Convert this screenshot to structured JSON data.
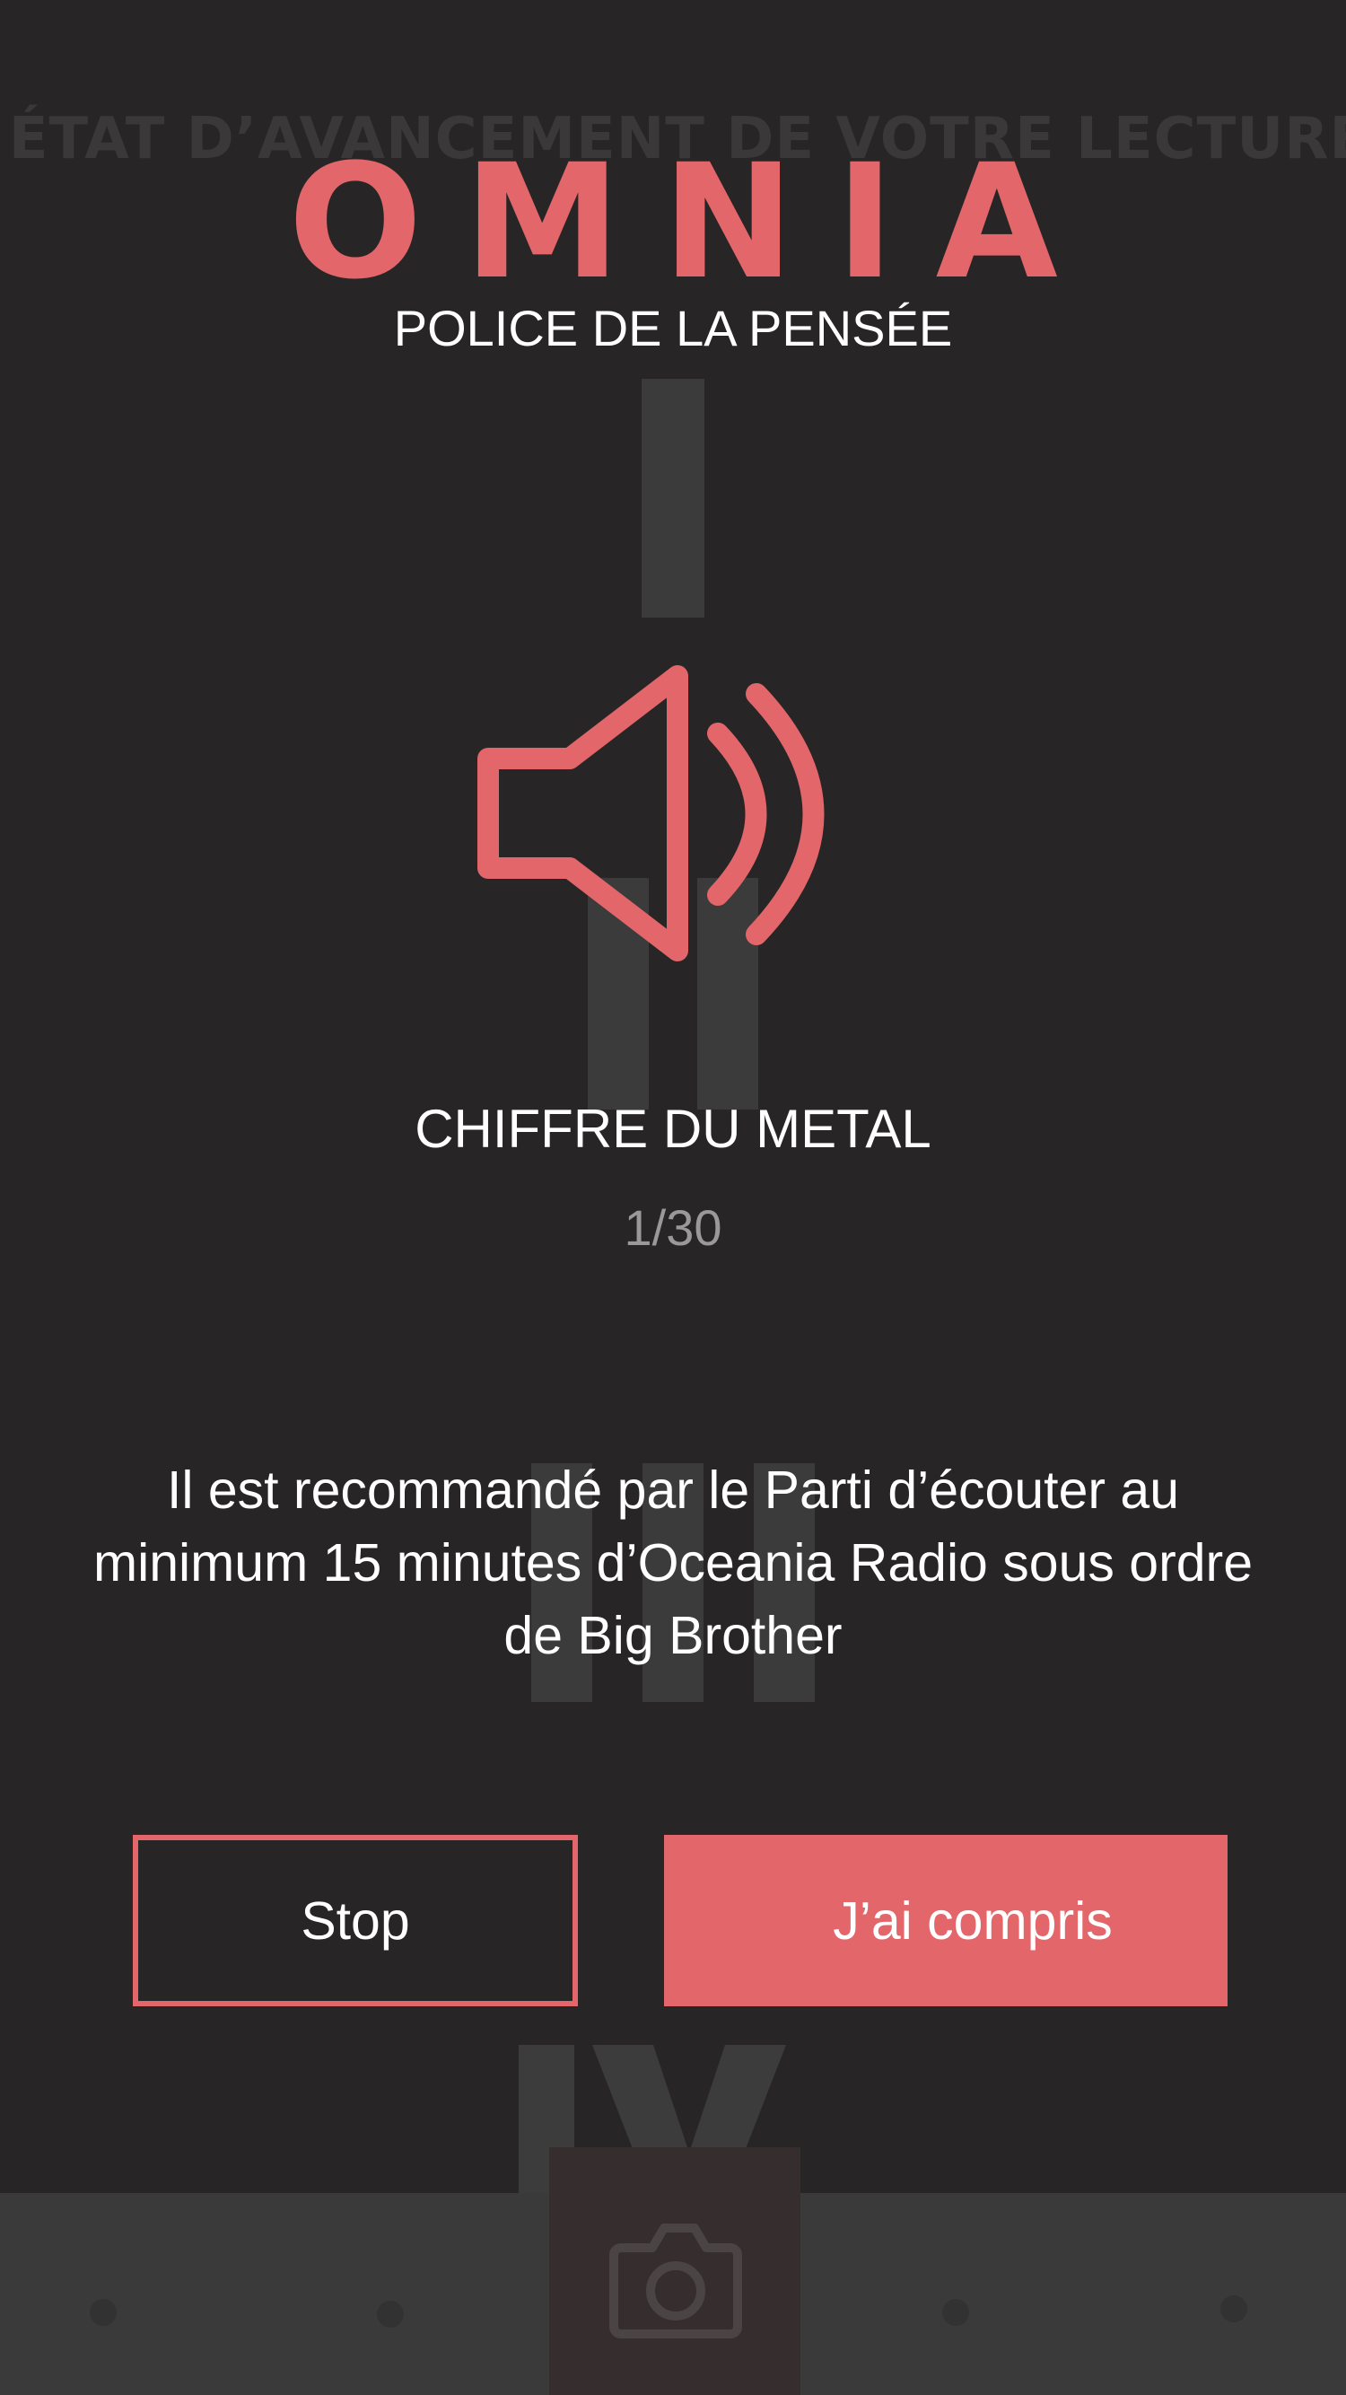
{
  "background": {
    "heading": "ÉTAT D’AVANCEMENT DE VOTRE LECTURE",
    "chapter_numerals": [
      "I",
      "II",
      "III",
      "IV"
    ],
    "bottom_nav": {
      "camera_icon": "camera-icon"
    }
  },
  "modal": {
    "brand": "OMNIA",
    "subtitle": "POLICE DE LA PENSÉE",
    "icon": "speaker-volume-icon",
    "section_title": "CHIFFRE DU METAL",
    "counter": "1/30",
    "message": "Il est recommandé par le Parti d’écouter au minimum 15 minutes d’Oceania Radio sous ordre de Big Brother",
    "buttons": {
      "stop_label": "Stop",
      "confirm_label": "J’ai compris"
    }
  },
  "colors": {
    "accent": "#e2666a",
    "background": "#272526",
    "dimmed": "#3c3b3c",
    "text": "#ffffff",
    "muted_text": "#9a9899"
  }
}
